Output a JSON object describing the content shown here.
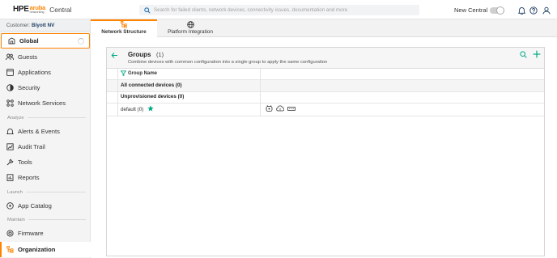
{
  "header": {
    "logo_hpe": "HPE",
    "logo_aruba": "aruba",
    "logo_networking": "networking",
    "app_name": "Central",
    "search_placeholder": "Search for failed clients, network devices, connectivity issues, documentation and more",
    "new_central_label": "New Central",
    "new_central_enabled": false
  },
  "sidebar": {
    "customer_label": "Customer:",
    "customer_name": "Blyott NV",
    "global_label": "Global",
    "items": [
      {
        "label": "Guests",
        "icon": "users-icon"
      },
      {
        "label": "Applications",
        "icon": "applications-icon"
      },
      {
        "label": "Security",
        "icon": "shield-icon"
      },
      {
        "label": "Network Services",
        "icon": "network-services-icon"
      }
    ],
    "section_analyze": "Analyze",
    "analyze_items": [
      {
        "label": "Alerts & Events",
        "icon": "bell-icon"
      },
      {
        "label": "Audit Trail",
        "icon": "audit-icon"
      },
      {
        "label": "Tools",
        "icon": "wrench-icon"
      },
      {
        "label": "Reports",
        "icon": "reports-icon"
      }
    ],
    "section_launch": "Launch",
    "launch_items": [
      {
        "label": "App Catalog",
        "icon": "app-catalog-icon"
      }
    ],
    "section_maintain": "Maintain",
    "maintain_items": [
      {
        "label": "Firmware",
        "icon": "firmware-icon"
      },
      {
        "label": "Organization",
        "icon": "organization-icon"
      }
    ]
  },
  "tabs": [
    {
      "label": "Network Structure",
      "icon": "network-structure-icon",
      "active": true
    },
    {
      "label": "Platform Integration",
      "icon": "globe-icon",
      "active": false
    }
  ],
  "groups": {
    "title": "Groups",
    "count": "(1)",
    "subtitle": "Combine devices with common configuration into a single group to apply the same configuration",
    "column_group_name": "Group Name",
    "rows": [
      {
        "name": "All connected devices (0)"
      },
      {
        "name": "Unprovisioned devices (0)"
      },
      {
        "name": "default (0)",
        "starred": true,
        "device_icons": [
          "access-point-icon",
          "gateway-icon",
          "switch-icon"
        ]
      }
    ]
  },
  "colors": {
    "accent": "#ff8300",
    "star": "#01a982",
    "nav_text": "#1f3d63"
  }
}
